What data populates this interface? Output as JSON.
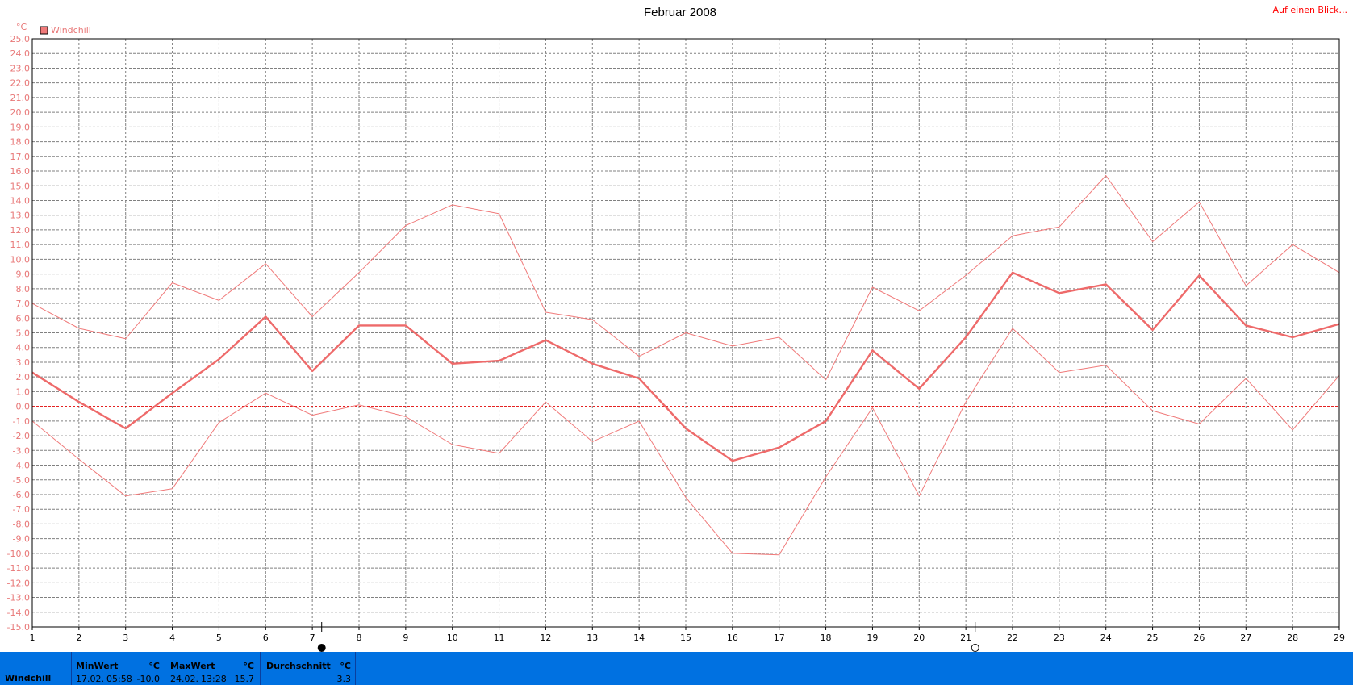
{
  "colors": {
    "series": "#f07a7a",
    "series_main": "#ee6a6a",
    "zero_line": "#ee1111",
    "grid": "#808080",
    "axis_labels": "#e87878",
    "accent_link": "#ff0000",
    "stats_bar": "#0071e1"
  },
  "header": {
    "top_link": "Auf einen Blick..."
  },
  "chart_data": {
    "type": "line",
    "title": "Februar 2008",
    "ylabel": "°C",
    "xlabel": "",
    "ylim": [
      -15,
      25
    ],
    "y_ticks": [
      "25.0",
      "24.0",
      "23.0",
      "22.0",
      "21.0",
      "20.0",
      "19.0",
      "18.0",
      "17.0",
      "16.0",
      "15.0",
      "14.0",
      "13.0",
      "12.0",
      "11.0",
      "10.0",
      "9.0",
      "8.0",
      "7.0",
      "6.0",
      "5.0",
      "4.0",
      "3.0",
      "2.0",
      "1.0",
      "0.0",
      "-1.0",
      "-2.0",
      "-3.0",
      "-4.0",
      "-5.0",
      "-6.0",
      "-7.0",
      "-8.0",
      "-9.0",
      "-10.0",
      "-11.0",
      "-12.0",
      "-13.0",
      "-14.0",
      "-15.0"
    ],
    "x": [
      "1",
      "2",
      "3",
      "4",
      "5",
      "6",
      "7",
      "8",
      "9",
      "10",
      "11",
      "12",
      "13",
      "14",
      "15",
      "16",
      "17",
      "18",
      "19",
      "20",
      "21",
      "22",
      "23",
      "24",
      "25",
      "26",
      "27",
      "28",
      "29"
    ],
    "grid": true,
    "legend": {
      "position": "top-left",
      "entries": [
        "Windchill"
      ]
    },
    "series": [
      {
        "name": "Windchill",
        "role": "max",
        "values": [
          7.0,
          5.3,
          4.6,
          8.4,
          7.2,
          9.7,
          6.1,
          9.1,
          12.3,
          13.7,
          13.1,
          6.4,
          5.9,
          3.4,
          5.0,
          4.1,
          4.7,
          1.8,
          8.1,
          6.5,
          8.9,
          11.6,
          12.2,
          15.7,
          11.2,
          13.9,
          8.2,
          11.0,
          9.1
        ]
      },
      {
        "name": "Windchill",
        "role": "average",
        "values": [
          2.3,
          0.3,
          -1.5,
          0.9,
          3.2,
          6.1,
          2.4,
          5.5,
          5.5,
          2.9,
          3.1,
          4.5,
          2.9,
          1.9,
          -1.5,
          -3.7,
          -2.8,
          -1.0,
          3.8,
          1.2,
          4.7,
          9.1,
          7.7,
          8.3,
          5.2,
          8.9,
          5.5,
          4.7,
          5.6
        ]
      },
      {
        "name": "Windchill",
        "role": "min",
        "values": [
          -1.0,
          -3.6,
          -6.1,
          -5.6,
          -1.1,
          0.9,
          -0.6,
          0.1,
          -0.7,
          -2.6,
          -3.2,
          0.3,
          -2.4,
          -1.0,
          -6.2,
          -10.0,
          -10.1,
          -4.8,
          -0.1,
          -6.1,
          0.3,
          5.3,
          2.3,
          2.8,
          -0.3,
          -1.2,
          1.9,
          -1.6,
          2.1
        ]
      }
    ],
    "markers": [
      {
        "x": 7.2,
        "type": "new-moon-icon"
      },
      {
        "x": 21.2,
        "type": "full-moon-icon"
      }
    ]
  },
  "stats": {
    "label": "Windchill",
    "min": {
      "header": "MinWert",
      "unit": "°C",
      "date": "17.02.",
      "time": "05:58",
      "value": "-10.0"
    },
    "max": {
      "header": "MaxWert",
      "unit": "°C",
      "date": "24.02.",
      "time": "13:28",
      "value": "15.7"
    },
    "avg": {
      "header": "Durchschnitt",
      "unit": "°C",
      "value": "3.3"
    }
  }
}
